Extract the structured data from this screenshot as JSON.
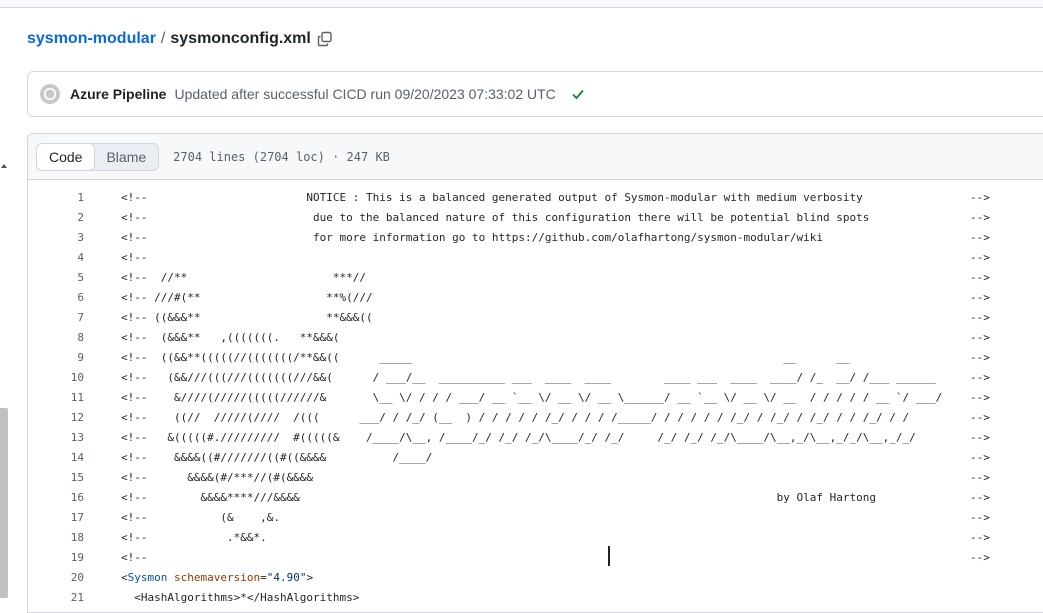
{
  "breadcrumb": {
    "repo": "sysmon-modular",
    "separator": "/",
    "file": "sysmonconfig.xml"
  },
  "commit": {
    "author": "Azure Pipeline",
    "message": "Updated after successful CICD run 09/20/2023 07:33:02 UTC",
    "status": "success",
    "status_color": "#1a7f37"
  },
  "file_header": {
    "tabs": [
      "Code",
      "Blame"
    ],
    "active_tab": "Code",
    "info": "2704 lines (2704 loc) · 247 KB"
  },
  "code_lines": [
    {
      "n": "1",
      "text": "<!--                        NOTICE : This is a balanced generated output of Sysmon-modular with medium verbosity",
      "close": "-->"
    },
    {
      "n": "2",
      "text": "<!--                         due to the balanced nature of this configuration there will be potential blind spots",
      "close": "-->"
    },
    {
      "n": "3",
      "text": "<!--                         for more information go to https://github.com/olafhartong/sysmon-modular/wiki",
      "close": "-->"
    },
    {
      "n": "4",
      "text": "<!--",
      "close": "-->"
    },
    {
      "n": "5",
      "text": "<!--  //**                      ***//",
      "close": "-->"
    },
    {
      "n": "6",
      "text": "<!-- ///#(**                   **%(///",
      "close": "-->"
    },
    {
      "n": "7",
      "text": "<!-- ((&&&**                   **&&&((",
      "close": "-->"
    },
    {
      "n": "8",
      "text": "<!--  (&&&**   ,(((((((.   **&&&(",
      "close": "-->"
    },
    {
      "n": "9",
      "text": "<!--  ((&&**(((((//(((((((/**&&((      _____                                                        __      __",
      "close": "-->"
    },
    {
      "n": "10",
      "text": "<!--   (&&///(((///(((((((///&&(      / ___/__  __________ ___  ____  ____        ____ ___  ____  ____/ /_  __/ /___ ______",
      "close": "-->"
    },
    {
      "n": "11",
      "text": "<!--    &////(/////(((((//////&       \\__ \\/ / / / ___/ __ `__ \\/ __ \\/ __ \\______/ __ `__ \\/ __ \\/ __  / / / / / __ `/ ___/",
      "close": "-->"
    },
    {
      "n": "12",
      "text": "<!--    ((//  /////(////  /(((      ___/ / /_/ (__  ) / / / / / /_/ / / / /_____/ / / / / / /_/ / /_/ / /_/ / / /_/ / /",
      "close": "-->"
    },
    {
      "n": "13",
      "text": "<!--   &(((((#./////////  #(((((&    /____/\\__, /____/_/ /_/ /_/\\____/_/ /_/     /_/ /_/ /_/\\____/\\__,_/\\__,_/_/\\__,_/_/",
      "close": "-->"
    },
    {
      "n": "14",
      "text": "<!--    &&&&((#///////((#((&&&&          /____/",
      "close": "-->"
    },
    {
      "n": "15",
      "text": "<!--      &&&&(#/***//(#(&&&&",
      "close": "-->"
    },
    {
      "n": "16",
      "text": "<!--        &&&&****///&&&&                                                                        by Olaf Hartong",
      "close": "-->"
    },
    {
      "n": "17",
      "text": "<!--           (&    ,&.",
      "close": "-->"
    },
    {
      "n": "18",
      "text": "<!--            .*&&*.",
      "close": "-->"
    },
    {
      "n": "19",
      "text": "<!--",
      "close": "-->"
    },
    {
      "n": "20",
      "text": "",
      "close": ""
    },
    {
      "n": "21",
      "text": "  <HashAlgorithms>*</HashAlgorithms>",
      "close": ""
    }
  ],
  "line20": {
    "open": "<",
    "tag": "Sysmon",
    "attr": " schemaversion",
    "eq": "=",
    "value": "\"4.90\"",
    "close": ">"
  }
}
